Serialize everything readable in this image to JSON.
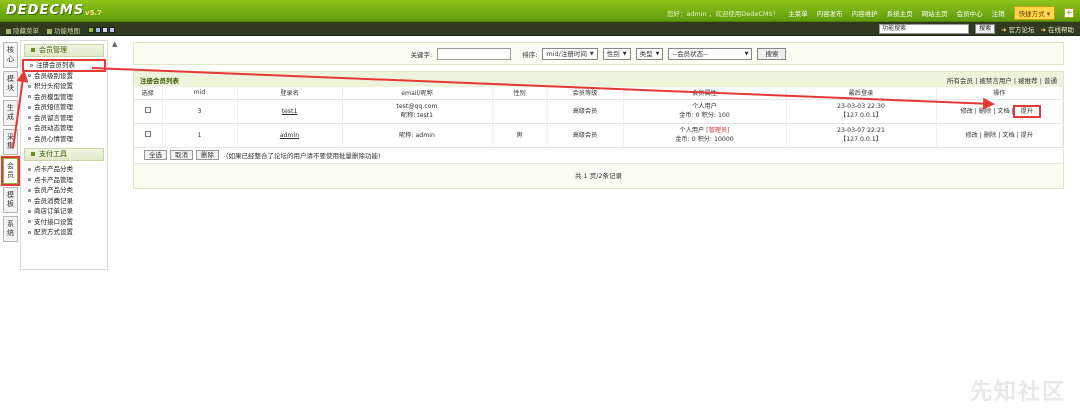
{
  "header": {
    "logo": "DEDECMS",
    "version": "v5.7",
    "welcome": "您好：admin ，欢迎使用DedeCMS！",
    "nav": [
      "主菜单",
      "内容发布",
      "内容维护",
      "系统主页",
      "网站主页",
      "会员中心",
      "注销"
    ],
    "quick_label": "快捷方式 ▾",
    "plus": "+"
  },
  "subbar": {
    "hide_menu": "隐藏菜单",
    "func_map": "功能地图",
    "search_placeholder": "功能搜索",
    "search_btn": "搜索",
    "forum": "官方论坛",
    "help": "在线帮助"
  },
  "vtabs": [
    "核心",
    "模块",
    "生成",
    "采集",
    "会员",
    "模板",
    "系统"
  ],
  "menu": {
    "group1": "会员管理",
    "items1": [
      "注册会员列表",
      "会员级别设置",
      "积分头衔设置",
      "会员模型管理",
      "会员短信管理",
      "会员留言管理",
      "会员动态管理",
      "会员心情管理"
    ],
    "group2": "支付工具",
    "items2": [
      "点卡产品分类",
      "点卡产品管理",
      "会员产品分类",
      "会员消费记录",
      "商店订单记录",
      "支付接口设置",
      "配货方式设置"
    ]
  },
  "search": {
    "keyword_label": "关键字:",
    "sort_label": "排序:",
    "sort_value": "mid/注册时间",
    "gender_value": "性别",
    "type_value": "类型",
    "status_value": "--会员状态--",
    "submit": "搜索"
  },
  "list": {
    "title": "注册会员列表",
    "filters": "所有会员 | 被禁言用户 | 被推荐 | 普通",
    "columns": [
      "选择",
      "mid",
      "登录名",
      "email/昵称",
      "性别",
      "会员等级",
      "会员属性",
      "最后登录",
      "操作"
    ],
    "rows": [
      {
        "mid": "3",
        "login": "test1",
        "email": "test@qq.com",
        "nick": "昵称: test1",
        "gender": "",
        "level": "高级会员",
        "attr1": "个人用户",
        "attr_tag": "",
        "attr2": "金币: 0 积分: 100",
        "time": "23-03-03 22:30",
        "ip": "【127.0.0.1】",
        "ops": "修改 | 删除 | 文档 |",
        "upgrade": "提升"
      },
      {
        "mid": "1",
        "login": "admin",
        "email": "",
        "nick": "昵称: admin",
        "gender": "男",
        "level": "高级会员",
        "attr1": "个人用户",
        "attr_tag": "[管理员]",
        "attr2": "金币: 0 积分: 10000",
        "time": "23-03-07 22:21",
        "ip": "【127.0.0.1】",
        "ops": "修改 | 删除 | 文档 |",
        "upgrade": "提升"
      }
    ],
    "select_all": "全选",
    "cancel": "取消",
    "delete": "删除",
    "note": "(如果已经整合了论坛的用户请不要使用批量删除功能)",
    "pager": "共 1 页/2条记录"
  },
  "watermark": "先知社区",
  "colors": {
    "accent": "#6a9e14",
    "annotation": "#e53935"
  }
}
